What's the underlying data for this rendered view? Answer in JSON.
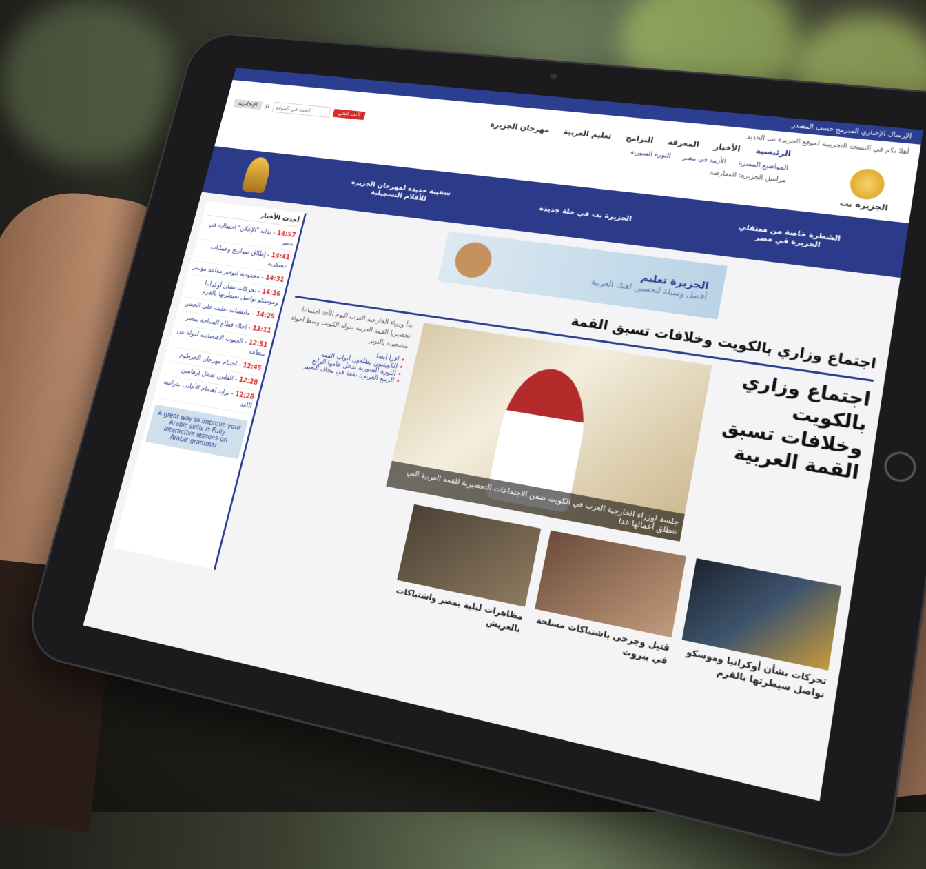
{
  "topbar": {
    "left_text": "الإرسال الإخباري المبرمج حسب المصدر",
    "right_text": ""
  },
  "header": {
    "welcome": "أهلا بكم في النسخة التجريبية لموقع الجزيرة نت الجديد",
    "logo_text": "الجزيرة نت",
    "nav": [
      "الرئيسية",
      "الأخبار",
      "المعرفة",
      "البرامج",
      "تعليم العربية",
      "مهرجان الجزيرة"
    ],
    "subnav": [
      "المواضيع المميزة",
      "الأزمة في مصر",
      "الثورة السورية"
    ],
    "ticker": "مراسل الجزيرة: المعارضة",
    "search_placeholder": "ابحث في الموقع",
    "live_label": "البث الحي",
    "edition_label": "الإنجليزية"
  },
  "promo": {
    "items": [
      "الشطرة خاصة من معتقلي الجزيرة في مصر",
      "الجزيرة نت في حلة جديدة",
      "سفينة جديدة لمهرجان الجزيرة للأفلام التسجيلية"
    ]
  },
  "ad": {
    "title": "الجزيرة تعليم",
    "subtitle": "أفضل وسيلة لتحسين لغتك العربية"
  },
  "main": {
    "headline_top": "اجتماع وزاري بالكويت وخلافات تسبق القمة",
    "headline_main": "اجتماع وزاري بالكويت وخلافات تسبق القمة العربية",
    "summary": "بدأ وزراء الخارجية العرب اليوم الأحد اجتماعا تحضيريا للقمة العربية بدولة الكويت وسط أجواء مشحونة بالتوتر",
    "caption": "جلسة لوزراء الخارجية العرب في الكويت ضمن الاجتماعات التحضيرية للقمة العربية التي تنطلق أعمالها غدا",
    "related": [
      "اقرأ أيضا",
      "الكويتيون يطلقون أبواب القمة",
      "الثورة السورية تدخل عامها الرابع",
      "الربيع العربي: بقعة في مجال التغيير"
    ]
  },
  "cards": [
    {
      "title": "تحركات بشأن أوكرانيا وموسكو تواصل سيطرتها بالقرم"
    },
    {
      "title": "قتيل وجرحى باشتباكات مسلحة في بيروت"
    },
    {
      "title": "مظاهرات ليلية بمصر واشتباكات بالعريش"
    }
  ],
  "sidebar": {
    "title": "أحدث الأخبار",
    "items": [
      {
        "time": "14:57",
        "text": "بداية \"الإعلان\" احتفالية في مصر"
      },
      {
        "time": "14:41",
        "text": "إطلاق صواريخ وعمليات عسكرية"
      },
      {
        "time": "14:31",
        "text": "محدودية لتوفير مقاعد مؤتمر"
      },
      {
        "time": "14:26",
        "text": "تحركات بشأن أوكرانيا وموسكو تواصل سيطرتها بالقرم"
      },
      {
        "time": "14:25",
        "text": "مليشيات تغلبت على الجيش"
      },
      {
        "time": "13:11",
        "text": "إخلاء قطاع السياحة بمصر"
      },
      {
        "time": "12:51",
        "text": "الجيوب الاقتصادية لدولة عن منطقة"
      },
      {
        "time": "12:45",
        "text": "اختتام مهرجان الخرطوم"
      },
      {
        "time": "12:28",
        "text": "الفلبين تعتقل إرهابيين"
      },
      {
        "time": "12:28",
        "text": "تزايد اهتمام الأجانب بدراسة اللغة"
      }
    ],
    "ad_text": "A great way to improve your Arabic skills is Fully interactive lessons on Arabic grammar"
  }
}
